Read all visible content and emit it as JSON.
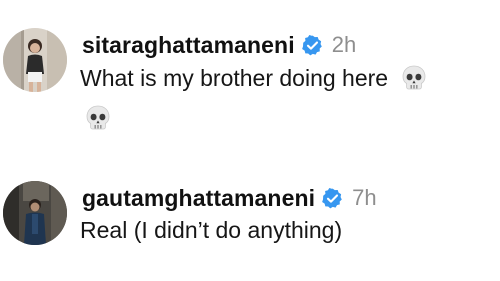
{
  "comments": [
    {
      "username": "sitaraghattamaneni",
      "verified": true,
      "time": "2h",
      "text": "What is my brother doing here",
      "emojis": [
        "skull-emoji",
        "skull-emoji"
      ]
    },
    {
      "username": "gautamghattamaneni",
      "verified": true,
      "time": "7h",
      "text": "Real (I didn’t do anything)",
      "emojis": []
    }
  ],
  "colors": {
    "verified_badge": "#3797f0",
    "timestamp": "#8e8e8e",
    "text": "#111111"
  }
}
